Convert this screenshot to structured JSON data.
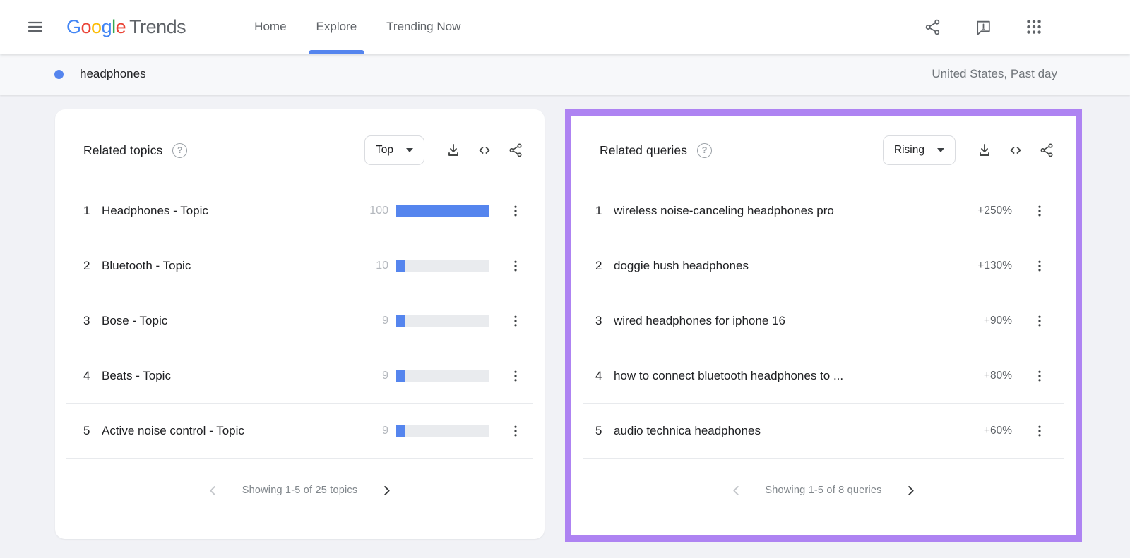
{
  "header": {
    "logo_letters": [
      {
        "ch": "G",
        "color": "#4285F4"
      },
      {
        "ch": "o",
        "color": "#EA4335"
      },
      {
        "ch": "o",
        "color": "#FBBC05"
      },
      {
        "ch": "g",
        "color": "#4285F4"
      },
      {
        "ch": "l",
        "color": "#34A853"
      },
      {
        "ch": "e",
        "color": "#EA4335"
      }
    ],
    "logo_suffix": "Trends",
    "nav": [
      {
        "label": "Home",
        "active": false
      },
      {
        "label": "Explore",
        "active": true
      },
      {
        "label": "Trending Now",
        "active": false
      }
    ],
    "icons": [
      "menu-icon",
      "share-icon",
      "feedback-icon",
      "google-apps-icon"
    ]
  },
  "term_bar": {
    "term": "headphones",
    "scope": "United States, Past day"
  },
  "related_topics": {
    "title": "Related topics",
    "sort_label": "Top",
    "toolbar_icons": [
      "download-icon",
      "embed-icon",
      "share-icon"
    ],
    "rows": [
      {
        "rank": "1",
        "label": "Headphones - Topic",
        "value": "100",
        "bar_pct": 100
      },
      {
        "rank": "2",
        "label": "Bluetooth - Topic",
        "value": "10",
        "bar_pct": 10
      },
      {
        "rank": "3",
        "label": "Bose - Topic",
        "value": "9",
        "bar_pct": 9
      },
      {
        "rank": "4",
        "label": "Beats - Topic",
        "value": "9",
        "bar_pct": 9
      },
      {
        "rank": "5",
        "label": "Active noise control - Topic",
        "value": "9",
        "bar_pct": 9
      }
    ],
    "footer": "Showing 1-5 of 25 topics"
  },
  "related_queries": {
    "title": "Related queries",
    "sort_label": "Rising",
    "toolbar_icons": [
      "download-icon",
      "embed-icon",
      "share-icon"
    ],
    "rows": [
      {
        "rank": "1",
        "label": "wireless noise-canceling headphones pro",
        "change": "+250%"
      },
      {
        "rank": "2",
        "label": "doggie hush headphones",
        "change": "+130%"
      },
      {
        "rank": "3",
        "label": "wired headphones for iphone 16",
        "change": "+90%"
      },
      {
        "rank": "4",
        "label": "how to connect bluetooth headphones to ...",
        "change": "+80%"
      },
      {
        "rank": "5",
        "label": "audio technica headphones",
        "change": "+60%"
      }
    ],
    "footer": "Showing 1-5 of 8 queries"
  },
  "colors": {
    "accent_blue": "#5585ee",
    "highlight_purple": "#ae83f2",
    "bar_track": "#e9ebee"
  }
}
